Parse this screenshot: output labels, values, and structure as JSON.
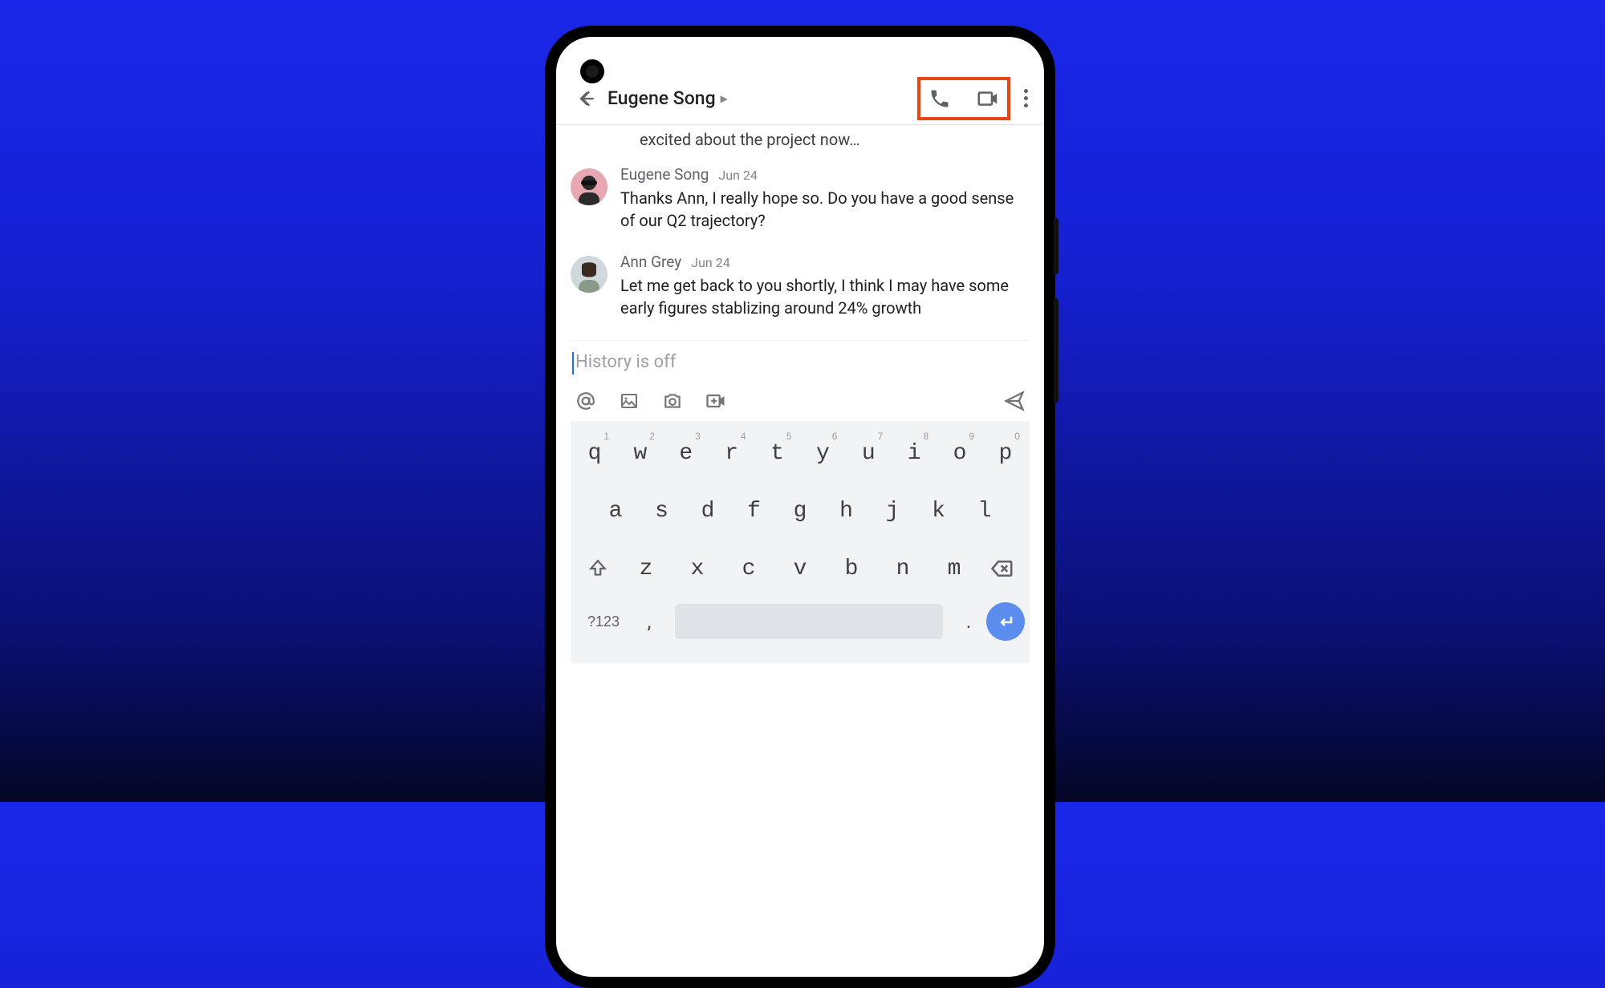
{
  "header": {
    "contact_name": "Eugene Song"
  },
  "cutoff_message": "excited about the project now…",
  "messages": [
    {
      "sender": "Eugene Song",
      "time": "Jun 24",
      "text": "Thanks Ann, I really hope so. Do you have a good sense of our Q2 trajectory?",
      "avatar": "eugene"
    },
    {
      "sender": "Ann Grey",
      "time": "Jun 24",
      "text": "Let me get back to you shortly, I think I may have some early figures stablizing around 24% growth",
      "avatar": "ann"
    }
  ],
  "compose": {
    "placeholder": "History is off"
  },
  "keyboard": {
    "row1": [
      {
        "main": "q",
        "hint": "1"
      },
      {
        "main": "w",
        "hint": "2"
      },
      {
        "main": "e",
        "hint": "3"
      },
      {
        "main": "r",
        "hint": "4"
      },
      {
        "main": "t",
        "hint": "5"
      },
      {
        "main": "y",
        "hint": "6"
      },
      {
        "main": "u",
        "hint": "7"
      },
      {
        "main": "i",
        "hint": "8"
      },
      {
        "main": "o",
        "hint": "9"
      },
      {
        "main": "p",
        "hint": "0"
      }
    ],
    "row2": [
      "a",
      "s",
      "d",
      "f",
      "g",
      "h",
      "j",
      "k",
      "l"
    ],
    "row3": [
      "z",
      "x",
      "c",
      "v",
      "b",
      "n",
      "m"
    ],
    "symbols_label": "?123",
    "comma": ",",
    "period": "."
  }
}
